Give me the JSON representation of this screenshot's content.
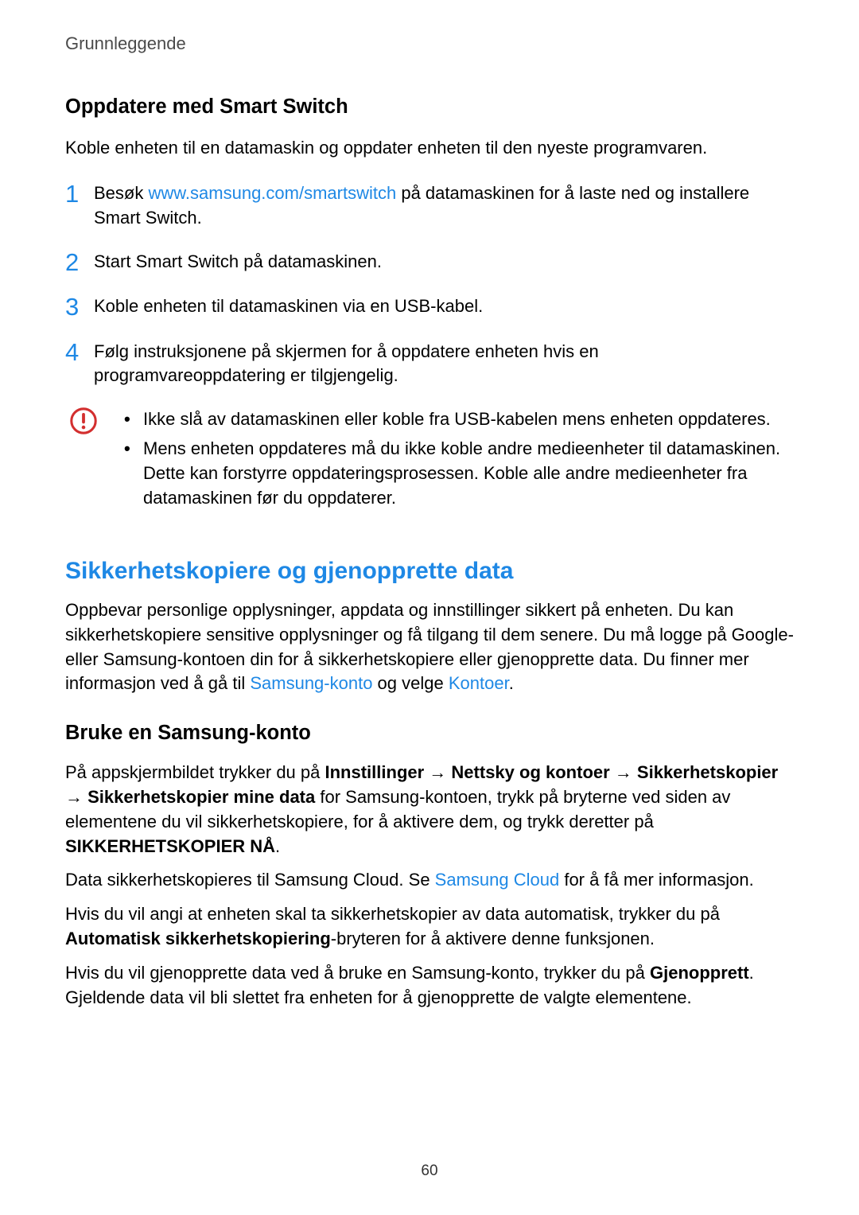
{
  "header": {
    "section": "Grunnleggende"
  },
  "smart_switch": {
    "heading": "Oppdatere med Smart Switch",
    "intro": "Koble enheten til en datamaskin og oppdater enheten til den nyeste programvaren.",
    "steps": [
      {
        "num": "1",
        "text_before": "Besøk ",
        "link": "www.samsung.com/smartswitch",
        "text_after": " på datamaskinen for å laste ned og installere Smart Switch."
      },
      {
        "num": "2",
        "text": "Start Smart Switch på datamaskinen."
      },
      {
        "num": "3",
        "text": "Koble enheten til datamaskinen via en USB-kabel."
      },
      {
        "num": "4",
        "text": "Følg instruksjonene på skjermen for å oppdatere enheten hvis en programvareoppdatering er tilgjengelig."
      }
    ],
    "caution": [
      "Ikke slå av datamaskinen eller koble fra USB-kabelen mens enheten oppdateres.",
      "Mens enheten oppdateres må du ikke koble andre medieenheter til datamaskinen. Dette kan forstyrre oppdateringsprosessen. Koble alle andre medieenheter fra datamaskinen før du oppdaterer."
    ]
  },
  "backup": {
    "heading": "Sikkerhetskopiere og gjenopprette data",
    "intro_before": "Oppbevar personlige opplysninger, appdata og innstillinger sikkert på enheten. Du kan sikkerhetskopiere sensitive opplysninger og få tilgang til dem senere. Du må logge på Google- eller Samsung-kontoen din for å sikkerhetskopiere eller gjenopprette data. Du finner mer informasjon ved å gå til ",
    "link1": "Samsung-konto",
    "intro_mid": " og velge ",
    "link2": "Kontoer",
    "intro_after": ".",
    "sub_heading": "Bruke en Samsung-konto",
    "p1_a": "På appskjermbildet trykker du på ",
    "p1_b1": "Innstillinger",
    "p1_arr": " → ",
    "p1_b2": "Nettsky og kontoer",
    "p1_b3": "Sikkerhetskopier",
    "p1_b4": "Sikkerhetskopier mine data",
    "p1_c": " for Samsung-kontoen, trykk på bryterne ved siden av elementene du vil sikkerhetskopiere, for å aktivere dem, og trykk deretter på ",
    "p1_d": "SIKKERHETSKOPIER NÅ",
    "p1_e": ".",
    "p2_a": "Data sikkerhetskopieres til Samsung Cloud. Se ",
    "p2_link": "Samsung Cloud",
    "p2_b": " for å få mer informasjon.",
    "p3_a": "Hvis du vil angi at enheten skal ta sikkerhetskopier av data automatisk, trykker du på ",
    "p3_b": "Automatisk sikkerhetskopiering",
    "p3_c": "-bryteren for å aktivere denne funksjonen.",
    "p4_a": "Hvis du vil gjenopprette data ved å bruke en Samsung-konto, trykker du på ",
    "p4_b": "Gjenopprett",
    "p4_c": ". Gjeldende data vil bli slettet fra enheten for å gjenopprette de valgte elementene."
  },
  "pagenum": "60"
}
